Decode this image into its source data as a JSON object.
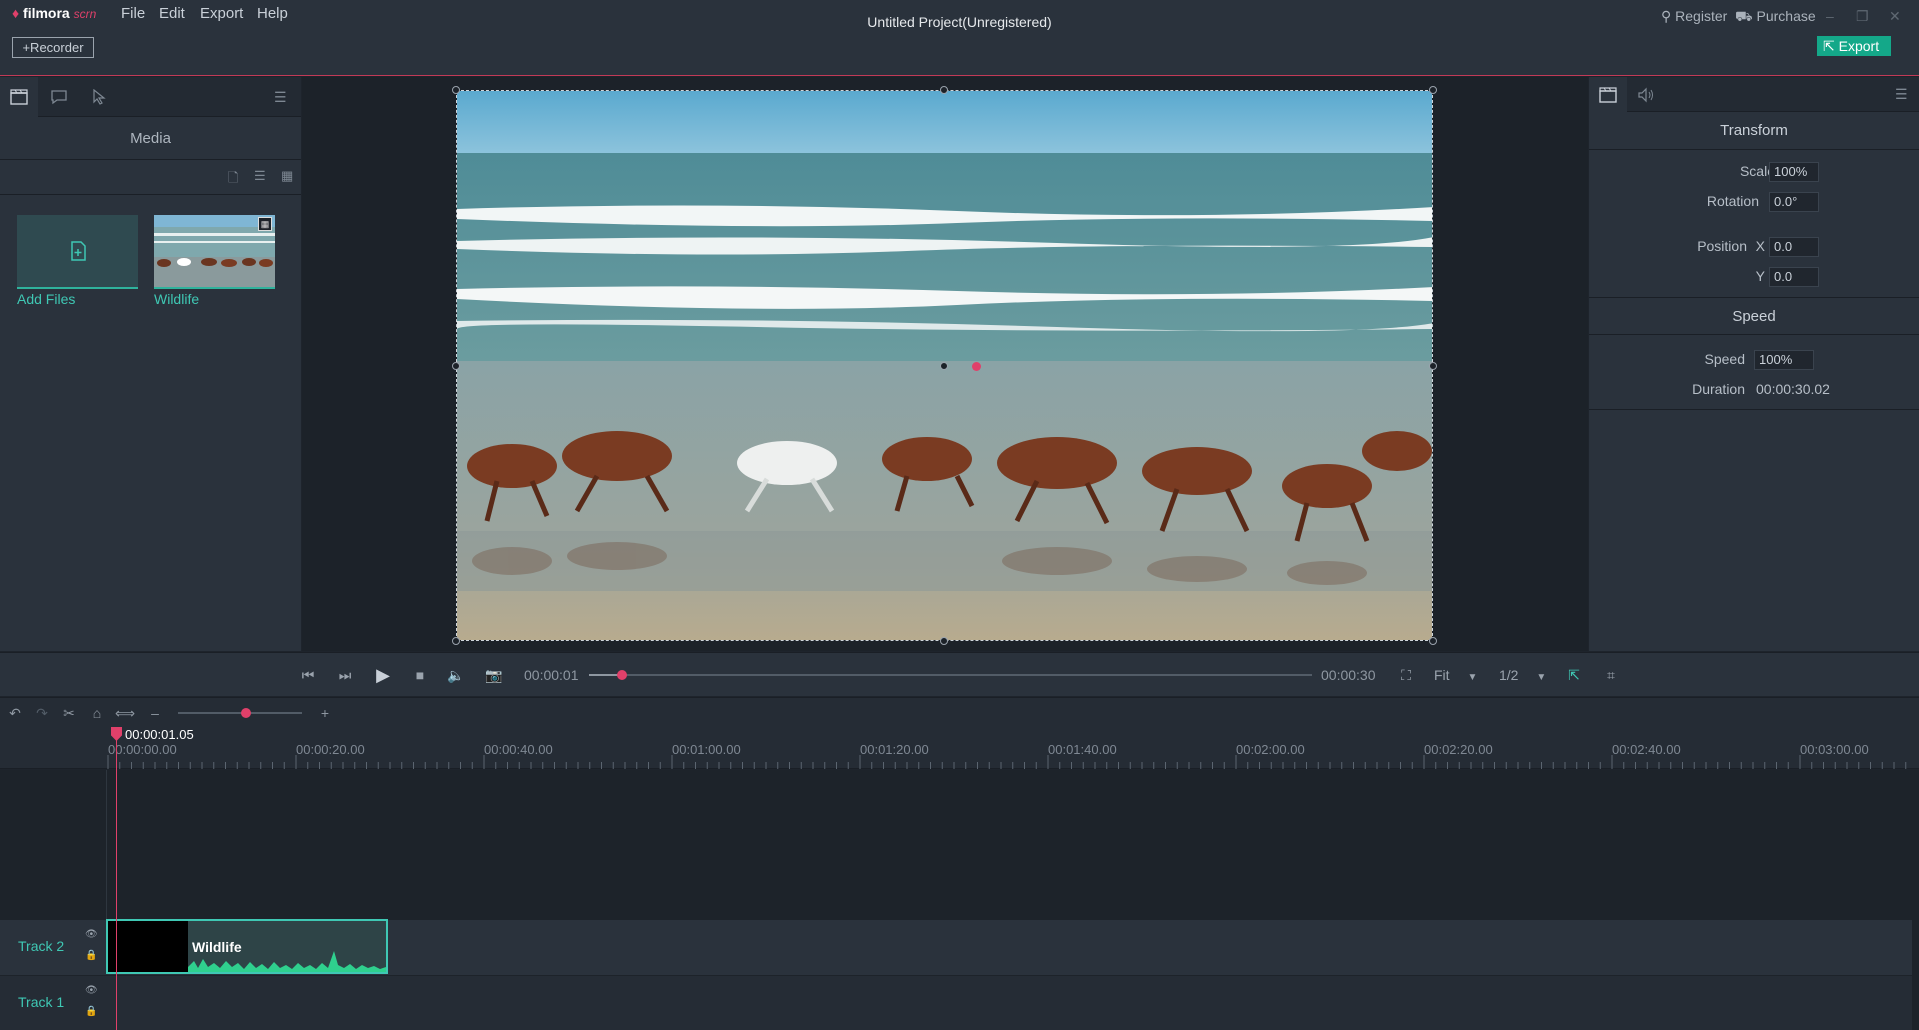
{
  "app": {
    "logo_main": "filmora",
    "logo_sub": "scrn",
    "project_title": "Untitled Project(Unregistered)"
  },
  "menu": [
    "File",
    "Edit",
    "Export",
    "Help"
  ],
  "toolbar": {
    "recorder_label": "+Recorder",
    "register_label": "Register",
    "purchase_label": "Purchase",
    "export_label": "Export"
  },
  "left_panel": {
    "title": "Media",
    "items": [
      {
        "label": "Add Files"
      },
      {
        "label": "Wildlife"
      }
    ]
  },
  "right_panel": {
    "transform_title": "Transform",
    "scale_label": "Scale",
    "scale_value": "100%",
    "rotation_label": "Rotation",
    "rotation_value": "0.0°",
    "position_label": "Position",
    "x_label": "X",
    "x_value": "0.0",
    "y_label": "Y",
    "y_value": "0.0",
    "speed_title": "Speed",
    "speed_label": "Speed",
    "speed_value": "100%",
    "duration_label": "Duration",
    "duration_value": "00:00:30.02"
  },
  "playback": {
    "current_time": "00:00:01",
    "total_time": "00:00:30",
    "progress": 0.045,
    "zoom_label": "Fit",
    "quality_label": "1/2"
  },
  "timeline": {
    "playhead_time": "00:00:01.05",
    "zoom_level": 0.55,
    "ticks": [
      "00:00:00.00",
      "00:00:20.00",
      "00:00:40.00",
      "00:01:00.00",
      "00:01:20.00",
      "00:01:40.00",
      "00:02:00.00",
      "00:02:20.00",
      "00:02:40.00",
      "00:03:00.00"
    ],
    "tracks": [
      {
        "label": "Track 2",
        "clip": "Wildlife"
      },
      {
        "label": "Track 1"
      }
    ]
  },
  "colors": {
    "accent": "#3fc8b4",
    "brand": "#e0406a",
    "export": "#14a889"
  }
}
